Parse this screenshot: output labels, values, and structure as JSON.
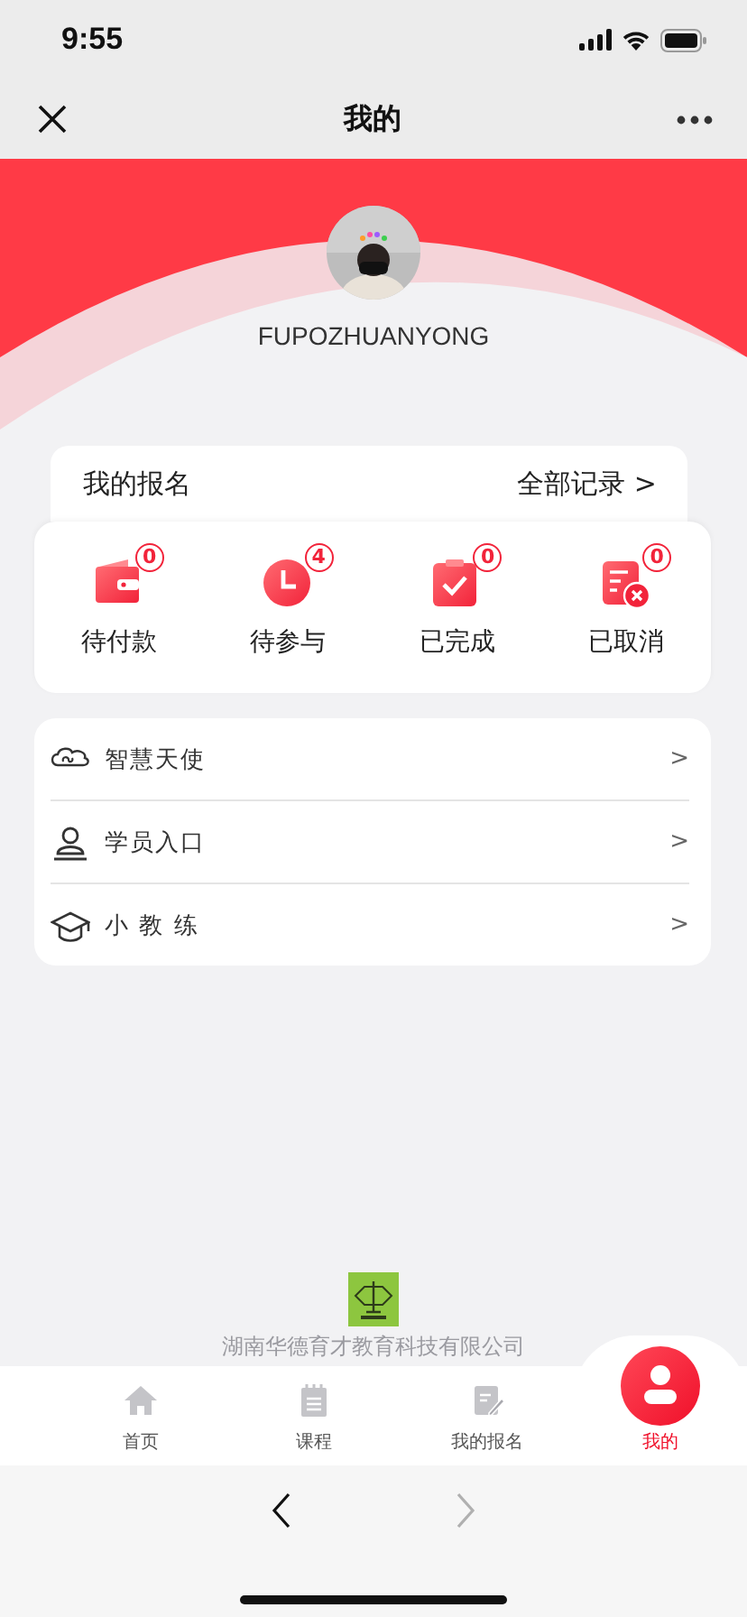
{
  "status_bar": {
    "time": "9:55"
  },
  "nav": {
    "title": "我的"
  },
  "profile": {
    "username": "FUPOZHUANYONG"
  },
  "registration": {
    "title": "我的报名",
    "link": "全部记录 >"
  },
  "statuses": [
    {
      "kind": "wallet",
      "label": "待付款",
      "count": "0"
    },
    {
      "kind": "clock",
      "label": "待参与",
      "count": "4"
    },
    {
      "kind": "clipboard",
      "label": "已完成",
      "count": "0"
    },
    {
      "kind": "cancel",
      "label": "已取消",
      "count": "0"
    }
  ],
  "menu": [
    {
      "kind": "cloud",
      "label": "智慧天使",
      "arrow": ">"
    },
    {
      "kind": "person",
      "label": "学员入口",
      "arrow": ">"
    },
    {
      "kind": "cap",
      "label": "小 教 练",
      "arrow": ">"
    }
  ],
  "footer": {
    "company": "湖南华德育才教育科技有限公司"
  },
  "tabs": [
    {
      "kind": "home",
      "label": "首页",
      "selected": false
    },
    {
      "kind": "list",
      "label": "课程",
      "selected": false
    },
    {
      "kind": "edit",
      "label": "我的报名",
      "selected": false
    },
    {
      "kind": "user",
      "label": "我的",
      "selected": true
    }
  ],
  "browser": {
    "back_disabled": false,
    "forward_disabled": true
  }
}
